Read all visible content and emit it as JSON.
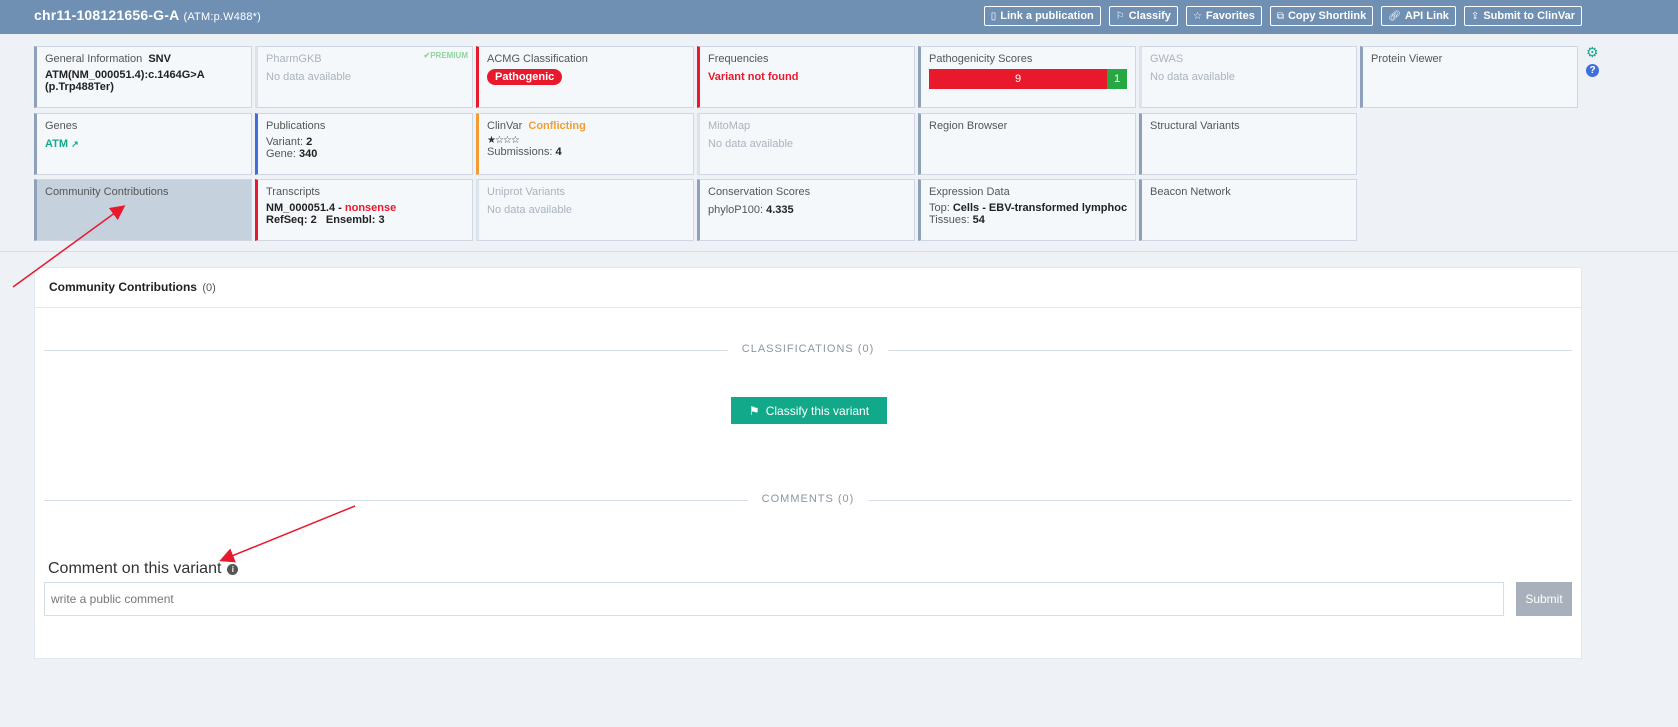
{
  "header": {
    "title": "chr11-108121656-G-A",
    "subtitle": "(ATM:p.W488*)",
    "actions": [
      {
        "label": "Link a publication",
        "icon": "document-icon"
      },
      {
        "label": "Classify",
        "icon": "flag-icon"
      },
      {
        "label": "Favorites",
        "icon": "star-icon"
      },
      {
        "label": "Copy Shortlink",
        "icon": "copy-icon"
      },
      {
        "label": "API Link",
        "icon": "link-icon"
      },
      {
        "label": "Submit to ClinVar",
        "icon": "upload-icon"
      }
    ]
  },
  "tiles": {
    "general": {
      "label": "General Information",
      "type": "SNV",
      "hgvs": "ATM(NM_000051.4):c.1464G>A",
      "protein": "(p.Trp488Ter)"
    },
    "pharmgkb": {
      "label": "PharmGKB",
      "value": "No data available",
      "badge": "PREMIUM"
    },
    "acmg": {
      "label": "ACMG Classification",
      "value": "Pathogenic"
    },
    "frequencies": {
      "label": "Frequencies",
      "value": "Variant not found"
    },
    "pathogenicity": {
      "label": "Pathogenicity Scores",
      "pathogenic": "9",
      "benign": "1"
    },
    "gwas": {
      "label": "GWAS",
      "value": "No data available"
    },
    "protein_viewer": {
      "label": "Protein Viewer"
    },
    "genes": {
      "label": "Genes",
      "value": "ATM"
    },
    "publications": {
      "label": "Publications",
      "variant_label": "Variant:",
      "variant": "2",
      "gene_label": "Gene:",
      "gene": "340"
    },
    "clinvar": {
      "label": "ClinVar",
      "status": "Conflicting",
      "stars": "★☆☆☆",
      "submissions_label": "Submissions:",
      "submissions": "4"
    },
    "mitomap": {
      "label": "MitoMap",
      "value": "No data available"
    },
    "region_browser": {
      "label": "Region Browser"
    },
    "structural_variants": {
      "label": "Structural Variants"
    },
    "community": {
      "label": "Community Contributions"
    },
    "transcripts": {
      "label": "Transcripts",
      "transcript": "NM_000051.4 -",
      "effect": "nonsense",
      "refseq_label": "RefSeq:",
      "refseq": "2",
      "ensembl_label": "Ensembl:",
      "ensembl": "3"
    },
    "uniprot": {
      "label": "Uniprot Variants",
      "value": "No data available"
    },
    "conservation": {
      "label": "Conservation Scores",
      "metric": "phyloP100:",
      "value": "4.335"
    },
    "expression": {
      "label": "Expression Data",
      "top_label": "Top:",
      "top": "Cells - EBV-transformed lymphocy...",
      "tissues_label": "Tissues:",
      "tissues": "54"
    },
    "beacon": {
      "label": "Beacon Network"
    }
  },
  "panel": {
    "title": "Community Contributions",
    "count": "(0)",
    "classifications_sep": "CLASSIFICATIONS (0)",
    "classify_button": "Classify this variant",
    "comments_sep": "COMMENTS (0)",
    "comment_title": "Comment on this variant",
    "comment_placeholder": "write a public comment",
    "submit_label": "Submit"
  },
  "colors": {
    "header_bg": "#6f8fb3",
    "pathogenic": "#e8192c",
    "benign": "#27a844",
    "accent": "#12a98a",
    "annotation_arrow": "#e8192c"
  }
}
